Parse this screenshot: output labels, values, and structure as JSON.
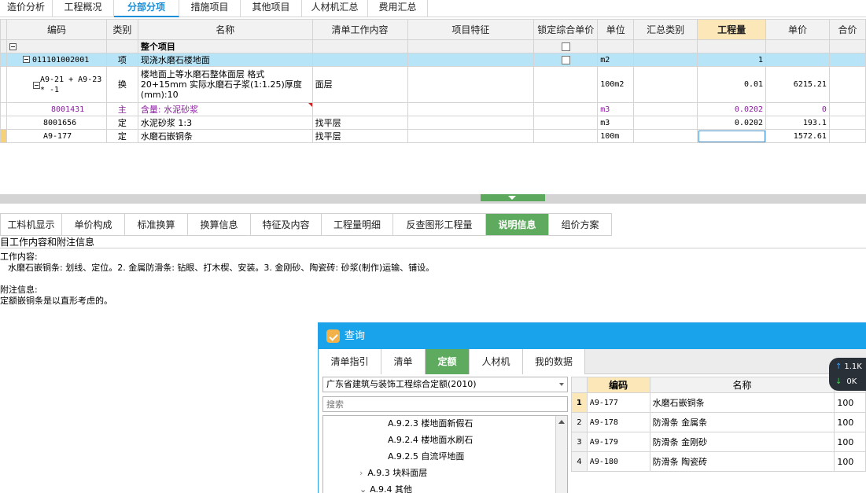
{
  "top_tabs": [
    "造价分析",
    "工程概况",
    "分部分项",
    "措施项目",
    "其他项目",
    "人材机汇总",
    "费用汇总"
  ],
  "top_tab_active": "分部分项",
  "grid": {
    "headers": [
      "编码",
      "类别",
      "名称",
      "清单工作内容",
      "项目特征",
      "锁定综合单价",
      "单位",
      "汇总类别",
      "工程量",
      "单价",
      "合价"
    ],
    "highlighted_header": "工程量",
    "rows": [
      {
        "code": "",
        "type": "",
        "name": "整个项目",
        "work": "",
        "unit": "",
        "qty": "",
        "price": ""
      },
      {
        "code": "011101002001",
        "type": "项",
        "name": "现浇水磨石楼地面",
        "work": "",
        "unit": "m2",
        "qty": "1",
        "price": ""
      },
      {
        "code": "A9-21 + A9-23 * -1",
        "type": "换",
        "name": "楼地面上等水磨石整体面层 格式 20+15mm  实际水磨石子浆(1:1.25)厚度(mm):10",
        "work": "面层",
        "unit": "100m2",
        "qty": "0.01",
        "price": "6215.21"
      },
      {
        "code": "8001431",
        "type": "主",
        "name": "含量: 水泥砂浆",
        "work": "",
        "unit": "m3",
        "qty": "0.0202",
        "price": "0"
      },
      {
        "code": "8001656",
        "type": "定",
        "name": "水泥砂浆 1:3",
        "work": "找平层",
        "unit": "m3",
        "qty": "0.0202",
        "price": "193.1"
      },
      {
        "code": "A9-177",
        "type": "定",
        "name": "水磨石嵌铜条",
        "work": "找平层",
        "unit": "100m",
        "qty": "",
        "price": "1572.61"
      }
    ]
  },
  "bottom_tabs": [
    "工料机显示",
    "单价构成",
    "标准换算",
    "换算信息",
    "特征及内容",
    "工程量明细",
    "反查图形工程量",
    "说明信息",
    "组价方案"
  ],
  "bottom_tab_active": "说明信息",
  "info": {
    "panel_title": "目工作内容和附注信息",
    "work_label": "工作内容:",
    "work_text": "水磨石嵌铜条: 划线、定位。2. 金属防滑条: 钻眼、打木楔、安装。3. 金刚砂、陶瓷砖: 砂浆(制作)运输、铺设。",
    "note_label": "附注信息:",
    "note_text": "定额嵌铜条是以直形考虑的。"
  },
  "query": {
    "title": "查询",
    "tabs": [
      "清单指引",
      "清单",
      "定额",
      "人材机",
      "我的数据"
    ],
    "active_tab": "定额",
    "library": "广东省建筑与装饰工程综合定额(2010)",
    "search_placeholder": "搜索",
    "tree": [
      "A.9.2.3 楼地面新假石",
      "A.9.2.4 楼地面水刷石",
      "A.9.2.5 自流坪地面",
      "A.9.3 块料面层",
      "A.9.4 其他"
    ],
    "result_headers": [
      "编码",
      "名称"
    ],
    "results": [
      {
        "idx": "1",
        "code": "A9-177",
        "name": "水磨石嵌铜条",
        "unit": "100"
      },
      {
        "idx": "2",
        "code": "A9-178",
        "name": "防滑条 金属条",
        "unit": "100"
      },
      {
        "idx": "3",
        "code": "A9-179",
        "name": "防滑条 金刚砂",
        "unit": "100"
      },
      {
        "idx": "4",
        "code": "A9-180",
        "name": "防滑条 陶瓷砖",
        "unit": "100"
      }
    ]
  },
  "speed": {
    "up": "1.1K",
    "down": "0K"
  }
}
